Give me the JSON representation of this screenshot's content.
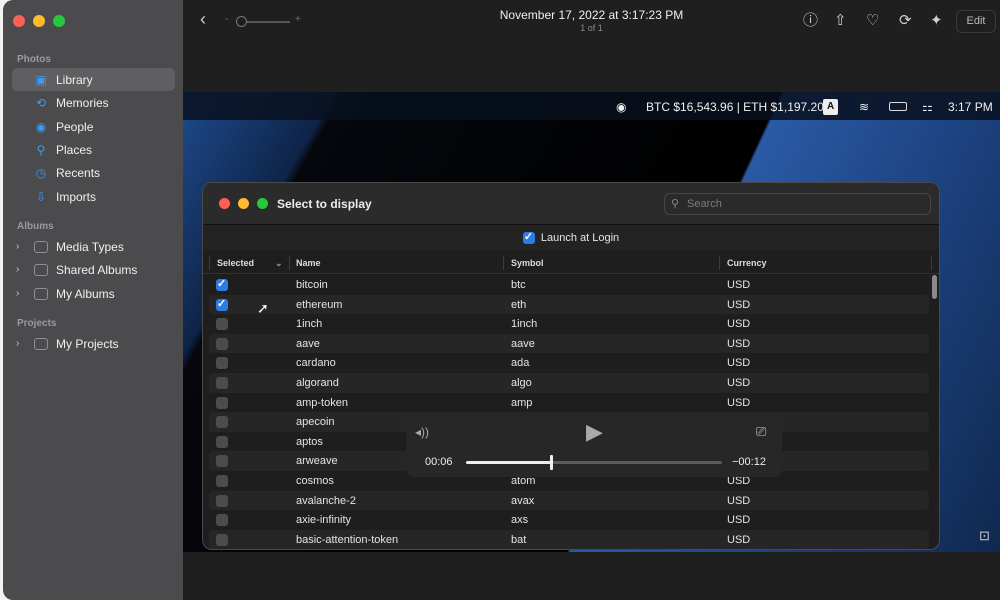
{
  "sidebar": {
    "sections": [
      {
        "label": "Photos",
        "items": [
          {
            "label": "Library",
            "icon": "library-icon",
            "selected": true
          },
          {
            "label": "Memories",
            "icon": "memories-icon"
          },
          {
            "label": "People",
            "icon": "people-icon"
          },
          {
            "label": "Places",
            "icon": "places-icon"
          },
          {
            "label": "Recents",
            "icon": "clock-icon"
          },
          {
            "label": "Imports",
            "icon": "import-icon"
          }
        ]
      },
      {
        "label": "Albums",
        "items": [
          {
            "label": "Media Types"
          },
          {
            "label": "Shared Albums"
          },
          {
            "label": "My Albums"
          }
        ]
      },
      {
        "label": "Projects",
        "items": [
          {
            "label": "My Projects"
          }
        ]
      }
    ]
  },
  "toolbar": {
    "title": "November 17, 2022 at 3:17:23 PM",
    "subtitle": "1 of 1",
    "zoom_minus": "-",
    "zoom_plus": "+",
    "edit_label": "Edit"
  },
  "menubar": {
    "ticker": "BTC $16,543.96 | ETH $1,197.20",
    "input_source": "A",
    "clock": "3:17 PM"
  },
  "dialog": {
    "title": "Select to display",
    "search_placeholder": "Search",
    "launch_at_login": {
      "label": "Launch at Login",
      "checked": true
    },
    "columns": [
      "Selected",
      "Name",
      "Symbol",
      "Currency"
    ],
    "rows": [
      {
        "selected": true,
        "name": "bitcoin",
        "symbol": "btc",
        "currency": "USD"
      },
      {
        "selected": true,
        "name": "ethereum",
        "symbol": "eth",
        "currency": "USD"
      },
      {
        "selected": false,
        "name": "1inch",
        "symbol": "1inch",
        "currency": "USD"
      },
      {
        "selected": false,
        "name": "aave",
        "symbol": "aave",
        "currency": "USD"
      },
      {
        "selected": false,
        "name": "cardano",
        "symbol": "ada",
        "currency": "USD"
      },
      {
        "selected": false,
        "name": "algorand",
        "symbol": "algo",
        "currency": "USD"
      },
      {
        "selected": false,
        "name": "amp-token",
        "symbol": "amp",
        "currency": "USD"
      },
      {
        "selected": false,
        "name": "apecoin",
        "symbol": "",
        "currency": ""
      },
      {
        "selected": false,
        "name": "aptos",
        "symbol": "",
        "currency": ""
      },
      {
        "selected": false,
        "name": "arweave",
        "symbol": "",
        "currency": ""
      },
      {
        "selected": false,
        "name": "cosmos",
        "symbol": "atom",
        "currency": "USD"
      },
      {
        "selected": false,
        "name": "avalanche-2",
        "symbol": "avax",
        "currency": "USD"
      },
      {
        "selected": false,
        "name": "axie-infinity",
        "symbol": "axs",
        "currency": "USD"
      },
      {
        "selected": false,
        "name": "basic-attention-token",
        "symbol": "bat",
        "currency": "USD"
      }
    ]
  },
  "player": {
    "elapsed": "00:06",
    "remaining": "−00:12",
    "progress": 0.333
  }
}
